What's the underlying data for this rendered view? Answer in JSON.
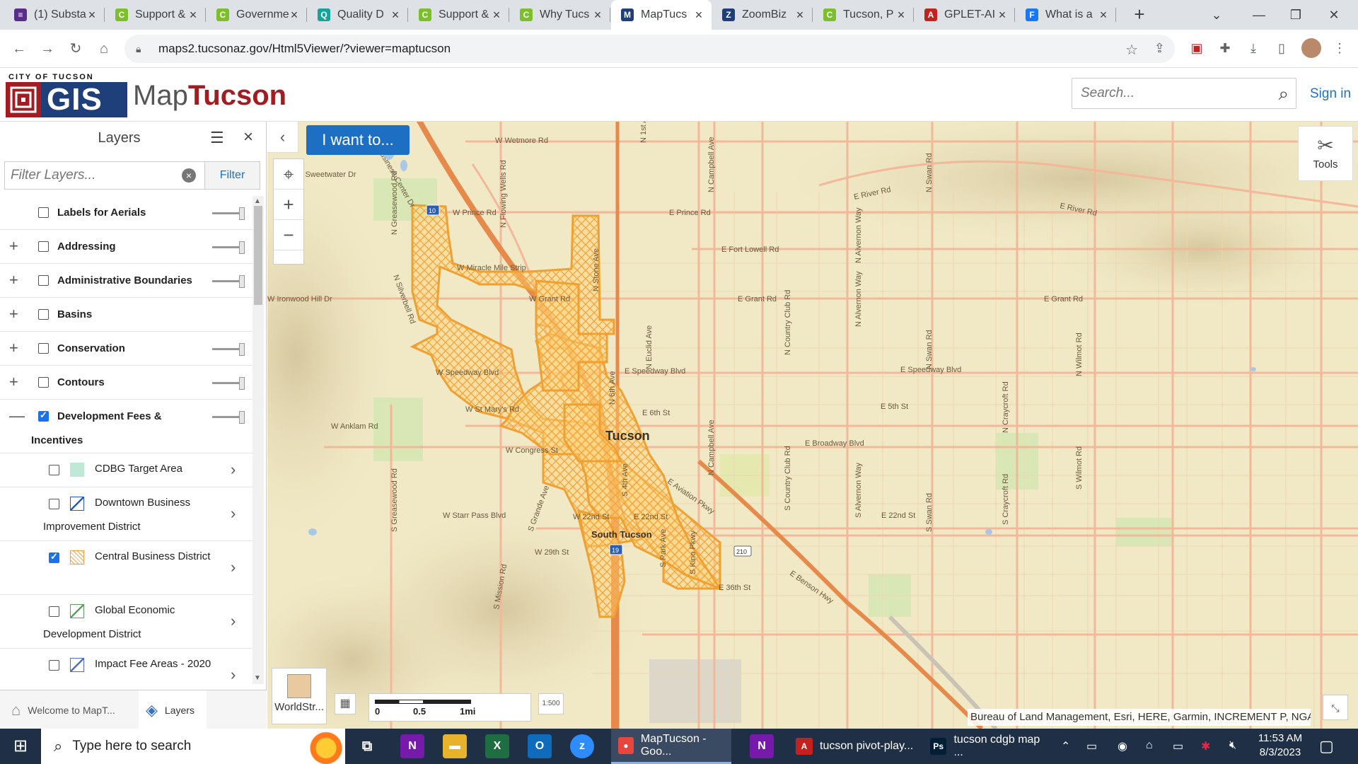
{
  "browser": {
    "tabs": [
      {
        "title": "(1) Substa",
        "icon": "substack-icon",
        "color": "#5a2d8a",
        "glyph": "≡"
      },
      {
        "title": "Support &",
        "icon": "support-icon",
        "color": "#7bbf2a",
        "glyph": "C"
      },
      {
        "title": "Governme",
        "icon": "support-icon",
        "color": "#7bbf2a",
        "glyph": "C"
      },
      {
        "title": "Quality D",
        "icon": "quality-icon",
        "color": "#16a39a",
        "glyph": "Q"
      },
      {
        "title": "Support &",
        "icon": "support-icon",
        "color": "#7bbf2a",
        "glyph": "C"
      },
      {
        "title": "Why Tucs",
        "icon": "support-icon",
        "color": "#7bbf2a",
        "glyph": "C"
      },
      {
        "title": "MapTucs",
        "icon": "maptucson-icon",
        "color": "#1f3f7a",
        "glyph": "M"
      },
      {
        "title": "ZoomBiz",
        "icon": "zoombiz-icon",
        "color": "#1f3f7a",
        "glyph": "Z"
      },
      {
        "title": "Tucson, P",
        "icon": "support-icon",
        "color": "#7bbf2a",
        "glyph": "C"
      },
      {
        "title": "GPLET-AI",
        "icon": "pdf-icon",
        "color": "#c5221f",
        "glyph": "A"
      },
      {
        "title": "What is a",
        "icon": "facebook-icon",
        "color": "#1877f2",
        "glyph": "F"
      }
    ],
    "active_tab": 6,
    "url": "maps2.tucsonaz.gov/Html5Viewer/?viewer=maptucson"
  },
  "header": {
    "logo_top": "CITY OF TUCSON",
    "logo_gis": "GIS",
    "title_a": "Map",
    "title_b": "Tucson",
    "search_placeholder": "Search...",
    "signin": "Sign in"
  },
  "layers_panel": {
    "title": "Layers",
    "filter_placeholder": "Filter Layers...",
    "filter_button": "Filter",
    "layers": [
      {
        "label": "Labels for Aerials",
        "expandable": false,
        "checked": false,
        "expand_glyph": ""
      },
      {
        "label": "Addressing",
        "expandable": true,
        "checked": false,
        "expand_glyph": "+"
      },
      {
        "label": "Administrative Boundaries",
        "expandable": true,
        "checked": false,
        "expand_glyph": "+"
      },
      {
        "label": "Basins",
        "expandable": true,
        "checked": false,
        "expand_glyph": "+"
      },
      {
        "label": "Conservation",
        "expandable": true,
        "checked": false,
        "expand_glyph": "+"
      },
      {
        "label": "Contours",
        "expandable": true,
        "checked": false,
        "expand_glyph": "+"
      },
      {
        "label": "Development Fees & Incentives",
        "expandable": true,
        "checked": true,
        "expand_glyph": "—"
      }
    ],
    "sublayers": [
      {
        "label": "CDBG Target Area",
        "checked": false,
        "swatch": "#bfe8d8"
      },
      {
        "label": "Downtown Business Improvement District",
        "checked": false,
        "swatch": "#1f5fbf"
      },
      {
        "label": "Central Business District",
        "checked": true,
        "swatch": "#f2a33a"
      },
      {
        "label": "Global Economic Development District",
        "checked": false,
        "swatch": "#5aa05a"
      },
      {
        "label": "Impact Fee Areas - 2020",
        "checked": false,
        "swatch": "#4a6fd0"
      }
    ],
    "bottom_tabs": [
      {
        "label": "Welcome to MapT...",
        "icon": "home-icon",
        "glyph": "⌂"
      },
      {
        "label": "Layers",
        "icon": "layers-icon",
        "glyph": "◈"
      }
    ]
  },
  "map": {
    "i_want_to": "I want to...",
    "tools": "Tools",
    "basemap": "WorldStr...",
    "scale": {
      "left": "0",
      "mid": "0.5",
      "right": "1mi"
    },
    "scale_button": "1:500",
    "attribution": "Bureau of Land Management, Esri, HERE, Garmin, INCREMENT P, NGA, USGS",
    "city_labels": [
      "Tucson",
      "South Tucson"
    ],
    "road_labels": {
      "wetmore": "W Wetmore Rd",
      "sweetwater": "W Sweetwater Dr",
      "prince_w": "W Prince Rd",
      "prince_e": "E Prince Rd",
      "river": "E River Rd",
      "river2": "E River Rd",
      "fortlowell": "E Fort Lowell Rd",
      "grant_w": "W Grant Rd",
      "grant_e": "E Grant Rd",
      "grant_e2": "E Grant Rd",
      "ironwood": "W Ironwood Hill Dr",
      "speedway_w": "W Speedway Blvd",
      "speedway_e": "E Speedway Blvd",
      "speedway_e2": "E Speedway Blvd",
      "sixth": "E 6th St",
      "fifth": "E 5th St",
      "anklam": "W Anklam Rd",
      "broadway": "E Broadway Blvd",
      "congress": "W Congress St",
      "starrpass": "W Starr Pass Blvd",
      "22nd_w": "W 22nd St",
      "22nd_e": "E 22nd St",
      "22nd_e2": "E 22nd St",
      "29th": "W 29th St",
      "36th": "E 36th St",
      "stmary": "W St Mary's Rd",
      "miracle": "W Miracle Mile Strip",
      "campbell": "N Campbell Ave",
      "campbell2": "N Campbell Ave",
      "swan": "N Swan Rd",
      "swan2": "N Swan Rd",
      "swan3": "S Swan Rd",
      "country": "N Country Club Rd",
      "country2": "S Country Club Rd",
      "alvernon": "N Alvernon Way",
      "alvernon2": "N Alvernon Way",
      "alvernon3": "S Alvernon Way",
      "craycroft": "N Craycroft Rd",
      "craycroft2": "S Craycroft Rd",
      "wilmot": "N Wilmot Rd",
      "wilmot2": "S Wilmot Rd",
      "euclid": "N Euclid Ave",
      "first": "N 1st Ave",
      "stone": "N Stone Ave",
      "sixthave": "N 6th Ave",
      "fourth": "S 4th Ave",
      "parkave": "S Park Ave",
      "kino": "S Kino Pkwy",
      "greasewood": "N Greasewood Rd",
      "greasewood2": "S Greasewood Rd",
      "silverbell": "N Silverbell Rd",
      "flowingwells": "N Flowing Wells Rd",
      "business": "N Business Center Dr",
      "grande": "S Grande Ave",
      "mission": "S Mission Rd",
      "i10": "10",
      "i19": "19",
      "r210": "210",
      "aviation": "E Aviation Pkwy",
      "benson": "E Benson Hwy"
    }
  },
  "taskbar": {
    "search_placeholder": "Type here to search",
    "apps": [
      {
        "label": "MapTucson - Goo...",
        "icon": "chrome-icon",
        "color": "#e8453c",
        "glyph": "●"
      },
      {
        "label": "tucson pivot-play...",
        "icon": "pdf-icon",
        "color": "#c5221f",
        "glyph": "A"
      },
      {
        "label": "tucson cdgb map ...",
        "icon": "photoshop-icon",
        "color": "#001e36",
        "glyph": "Ps"
      }
    ],
    "time": "11:53 AM",
    "date": "8/3/2023"
  }
}
